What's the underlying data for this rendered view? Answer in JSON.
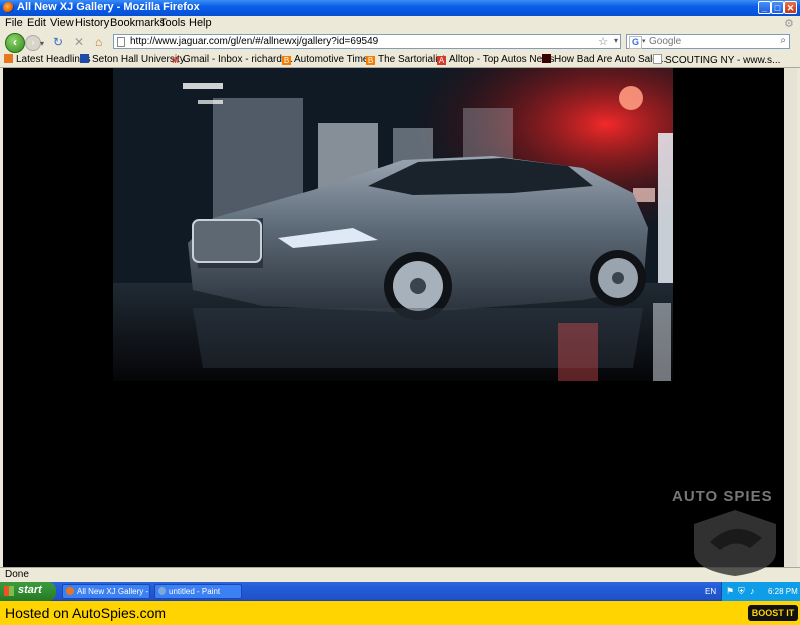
{
  "window": {
    "title": "All New XJ Gallery - Mozilla Firefox"
  },
  "menu": [
    "File",
    "Edit",
    "View",
    "History",
    "Bookmarks",
    "Tools",
    "Help"
  ],
  "nav": {
    "url": "http://www.jaguar.com/gl/en/#/allnewxj/gallery?id=69549",
    "search_placeholder": "Google"
  },
  "bookmarks": [
    {
      "label": "Latest Headlines",
      "icon": "rss-icon",
      "color": "#e8761e"
    },
    {
      "label": "Seton Hall University",
      "icon": "university-icon",
      "color": "#1f4aa8"
    },
    {
      "label": "Gmail - Inbox - richard....",
      "icon": "gmail-icon",
      "color": "#d33a2c"
    },
    {
      "label": "Automotive Times",
      "icon": "blogger-icon",
      "color": "#f57d00"
    },
    {
      "label": "The Sartorialist",
      "icon": "blogger-icon",
      "color": "#f57d00"
    },
    {
      "label": "Alltop - Top Autos News",
      "icon": "alltop-icon",
      "color": "#d33a2c"
    },
    {
      "label": "How Bad Are Auto Sale...",
      "icon": "page-dark-icon",
      "color": "#3a0000"
    },
    {
      "label": "SCOUTING NY - www.s...",
      "icon": "page-icon",
      "color": "#dddddd"
    }
  ],
  "status": "Done",
  "taskbar": {
    "start": "start",
    "tasks": [
      "All New XJ Gallery - M...",
      "untitled - Paint"
    ],
    "tray": {
      "lang": "EN",
      "time": "6:28 PM"
    }
  },
  "watermark": "AUTO SPIES",
  "footer": {
    "hosted": "Hosted on AutoSpies.com",
    "boost": "BOOST IT"
  }
}
